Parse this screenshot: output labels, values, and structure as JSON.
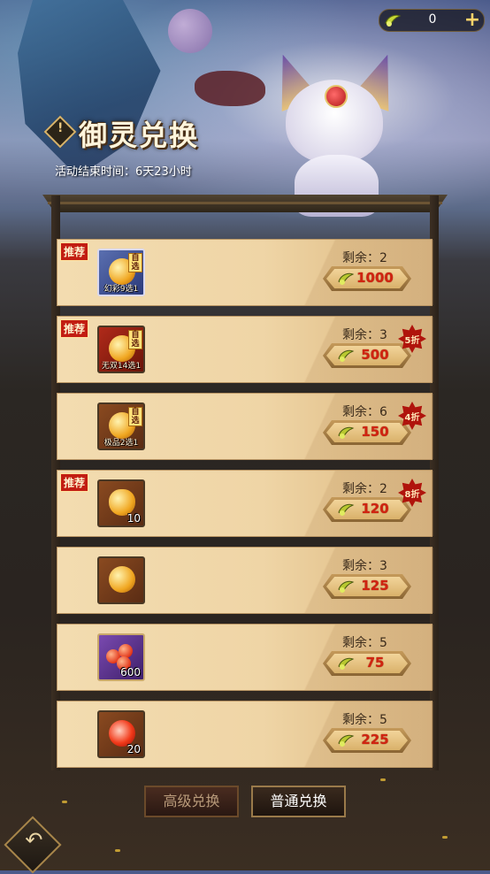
{
  "currency": {
    "value": "0",
    "icon": "spirit-jade-icon",
    "add_icon": "plus-icon"
  },
  "title": "御灵兑换",
  "title_mark": "!",
  "subtitle": "活动结束时间：6天23小时",
  "rows": [
    {
      "tag": "推荐",
      "item_icon": "gold-orb-icon",
      "select_badge": "自选",
      "item_name": "幻彩9选1",
      "item_count": "",
      "remain": "剩余：2",
      "price": "1000",
      "discount": ""
    },
    {
      "tag": "推荐",
      "item_icon": "gold-orb-icon",
      "select_badge": "自选",
      "item_name": "无双14选1",
      "item_count": "",
      "remain": "剩余：3",
      "price": "500",
      "discount": "5折"
    },
    {
      "tag": "",
      "item_icon": "gold-orb-icon",
      "select_badge": "自选",
      "item_name": "极品2选1",
      "item_count": "",
      "remain": "剩余：6",
      "price": "150",
      "discount": "4折"
    },
    {
      "tag": "推荐",
      "item_icon": "potion-bottle-icon",
      "select_badge": "",
      "item_name": "",
      "item_count": "10",
      "remain": "剩余：2",
      "price": "120",
      "discount": "8折"
    },
    {
      "tag": "",
      "item_icon": "golden-bowl-icon",
      "select_badge": "",
      "item_name": "",
      "item_count": "",
      "remain": "剩余：3",
      "price": "125",
      "discount": ""
    },
    {
      "tag": "",
      "item_icon": "fruit-bundle-icon",
      "select_badge": "",
      "item_name": "",
      "item_count": "600",
      "remain": "剩余：5",
      "price": "75",
      "discount": ""
    },
    {
      "tag": "",
      "item_icon": "fire-orb-icon",
      "select_badge": "",
      "item_name": "",
      "item_count": "20",
      "remain": "剩余：5",
      "price": "225",
      "discount": ""
    }
  ],
  "tabs": {
    "advanced": "高级兑换",
    "normal": "普通兑换",
    "active": "normal"
  },
  "back_icon": "back-arrow-icon",
  "colors": {
    "price_red": "#d02410",
    "tag_red": "#c21d12",
    "card_bg": "#efd5a6"
  }
}
